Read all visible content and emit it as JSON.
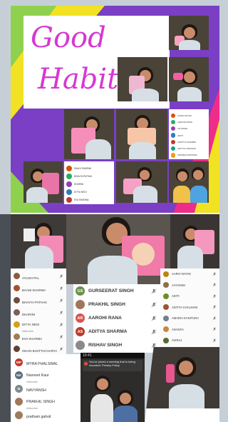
{
  "collage_top": {
    "title_line1": "Good",
    "title_line2": "Habits",
    "colors": {
      "purple": "#7a3fc4",
      "yellow": "#f2e224",
      "green": "#8fd14f",
      "magenta": "#ee2c8a",
      "title": "#d638d2"
    },
    "mini_list_1": [
      "RAAHI SHARMA",
      "BHAVYA PATHAK",
      "DHARINI",
      "DITYA NEGI",
      "EVA SHARMA"
    ],
    "mini_list_2": [
      "AASHI NAYAK",
      "AAROHI RANA",
      "AAYANSH",
      "ADITI",
      "AADITYA SHARMA",
      "ADITYA CHAUHAN",
      "AMAIRA KANITURA"
    ]
  },
  "list_left": [
    {
      "name": "AYUSH PAL",
      "sub": ""
    },
    {
      "name": "BAANI SHARMA",
      "sub": ""
    },
    {
      "name": "BHAVYA PATHAK",
      "sub": ""
    },
    {
      "name": "DHARINI",
      "sub": ""
    },
    {
      "name": "DITYA NEGI",
      "sub": "Attendee"
    },
    {
      "name": "EVA SHARMA",
      "sub": ""
    },
    {
      "name": "ISHAN BHATTACHARYA",
      "sub": ""
    }
  ],
  "list_center": [
    {
      "initials": "GS",
      "name": "GURSEERAT SINGH",
      "color": "#6b8f4e"
    },
    {
      "initials": "",
      "name": "PRAKHIL SINGH",
      "color": "#a0775a"
    },
    {
      "initials": "AR",
      "name": "AAROHI RANA",
      "color": "#d9534f"
    },
    {
      "initials": "AS",
      "name": "ADITYA  SHARMA",
      "color": "#c0392b"
    },
    {
      "initials": "",
      "name": "RISHAV SINGH",
      "color": "#8a8a8a"
    }
  ],
  "list_right": [
    {
      "name": "AARVI NAYAK"
    },
    {
      "name": "AAYANSH"
    },
    {
      "name": "ADITI"
    },
    {
      "name": "ADITYA CHAUHAN"
    },
    {
      "name": "AMAIRA KANITURA"
    },
    {
      "name": "ANANYA"
    },
    {
      "name": "AVIRAJ"
    }
  ],
  "list_bottom": [
    {
      "initials": "MP",
      "name": "MYRA PHALSWAL",
      "sub": "",
      "color": "#c0392b"
    },
    {
      "initials": "NK",
      "name": "Navneet  Kaur",
      "sub": "Attendee",
      "color": "#5d6d7e"
    },
    {
      "initials": "N",
      "name": "NAVYANSH",
      "sub": "",
      "color": "#7f8c8d"
    },
    {
      "initials": "",
      "name": "PRAKHIL SINGH",
      "sub": "Attendee",
      "color": "#a0775a"
    },
    {
      "initials": "",
      "name": "pratham gahoit",
      "sub": "",
      "color": "#9c7c5c"
    }
  ],
  "banner": {
    "status_time": "10:41 ",
    "text": "You've joined a meeting that is being recorded. Privacy Policy"
  }
}
